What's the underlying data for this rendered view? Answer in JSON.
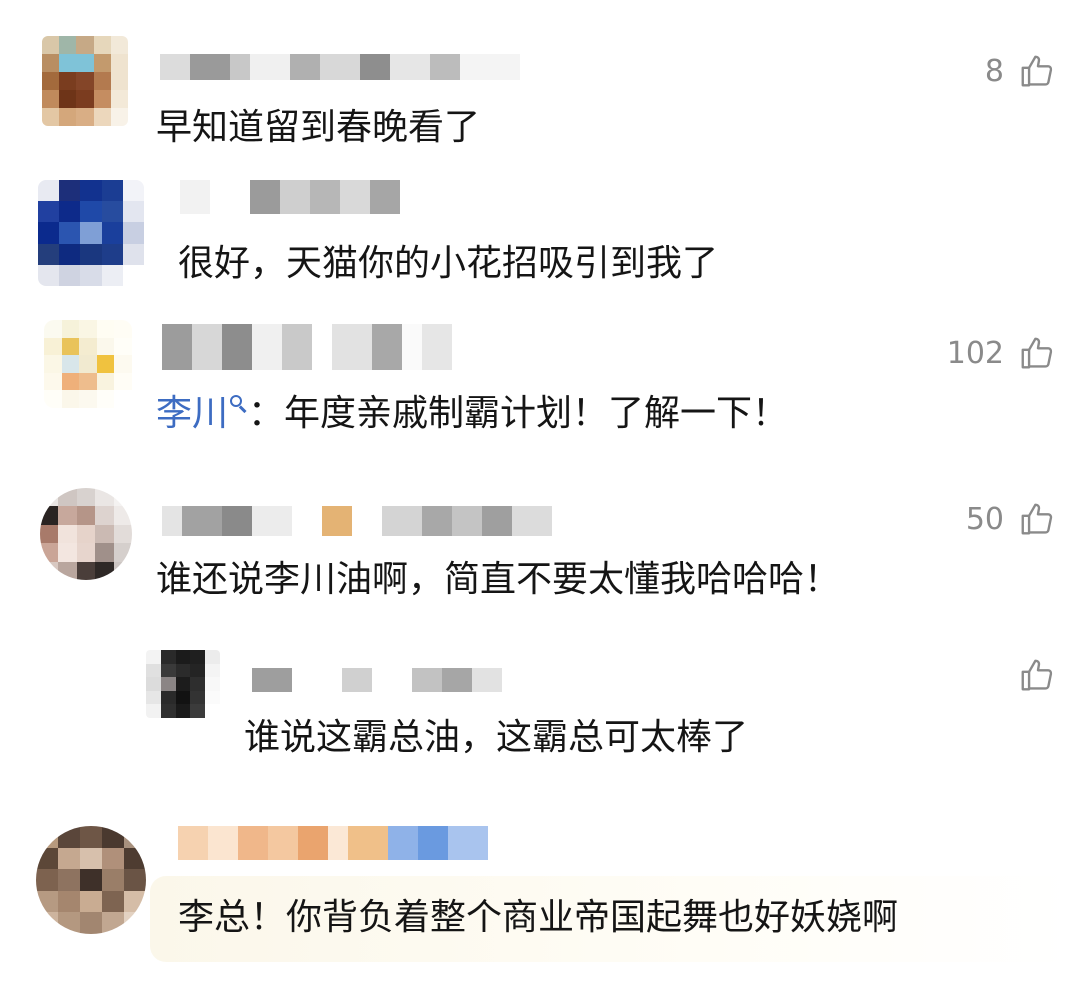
{
  "comments": [
    {
      "text": "早知道留到春晚看了",
      "likes": "8"
    },
    {
      "text": "很好，天猫你的小花招吸引到我了",
      "likes": ""
    },
    {
      "mention": "李川",
      "mention_icon": "search-icon",
      "text": "：年度亲戚制霸计划！了解一下！",
      "likes": "102"
    },
    {
      "text": "谁还说李川油啊，简直不要太懂我哈哈哈！",
      "likes": "50"
    },
    {
      "text": "谁说这霸总油，这霸总可太棒了",
      "likes": "",
      "is_reply": true
    },
    {
      "text": "李总！你背负着整个商业帝国起舞也好妖娆啊",
      "likes": ""
    }
  ],
  "colors": {
    "mention": "#3d6cc2",
    "like_icon": "#8a8a8a"
  },
  "icons": {
    "like": "thumbs-up-icon"
  }
}
